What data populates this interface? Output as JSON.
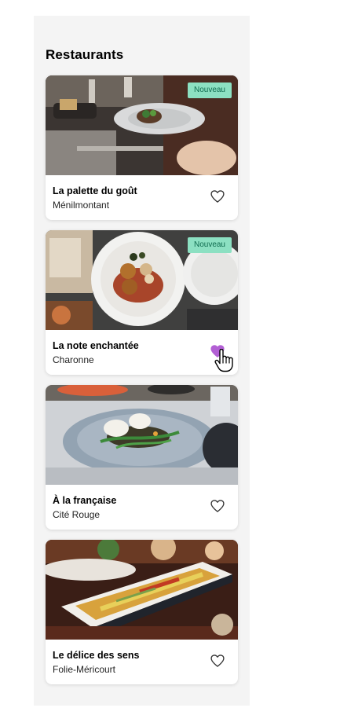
{
  "page": {
    "title": "Restaurants"
  },
  "badge_label": "Nouveau",
  "colors": {
    "panel_background": "#f4f4f4",
    "badge_background": "#8ce0c2",
    "badge_text": "#0f6b4f",
    "favorite_active": "#b25fd4",
    "favorite_inactive": "#333333"
  },
  "restaurants": [
    {
      "name": "La palette du goût",
      "area": "Ménilmontant",
      "badge": "Nouveau",
      "favorite": false,
      "photo": "plated-dish-table-photo"
    },
    {
      "name": "La note enchantée",
      "area": "Charonne",
      "badge": "Nouveau",
      "favorite": true,
      "photo": "meatballs-plate-photo"
    },
    {
      "name": "À la française",
      "area": "Cité Rouge",
      "badge": "",
      "favorite": false,
      "photo": "poached-eggs-plate-photo"
    },
    {
      "name": "Le délice des sens",
      "area": "Folie-Méricourt",
      "badge": "",
      "favorite": false,
      "photo": "grilled-fish-platter-photo"
    }
  ],
  "icons": {
    "favorite": "heart-icon",
    "pointer": "hand-pointer-icon"
  }
}
